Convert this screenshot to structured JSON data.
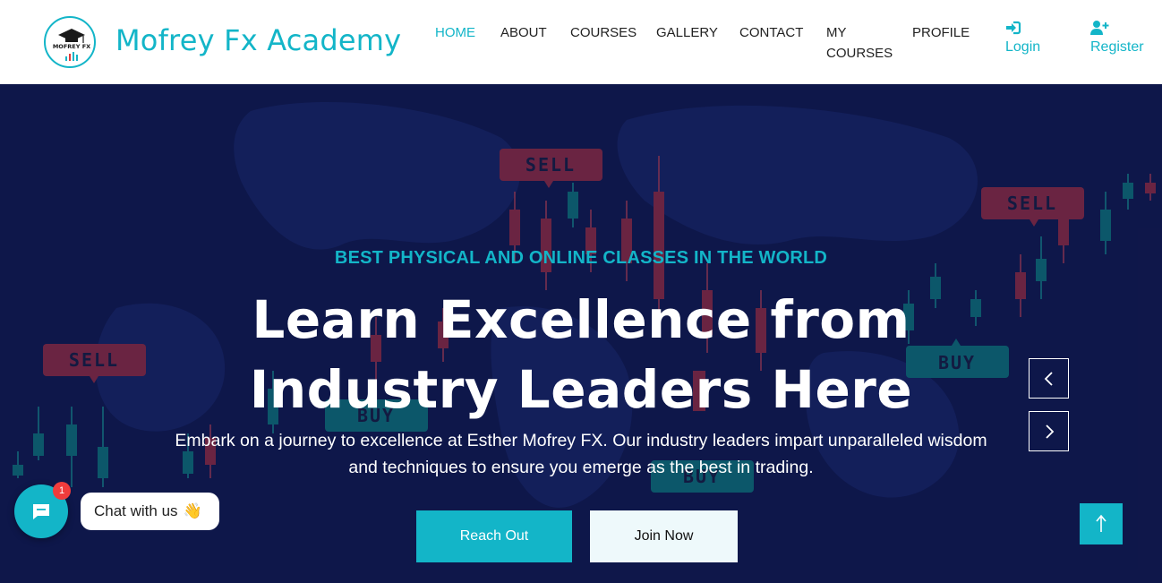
{
  "brand": {
    "name": "Mofrey Fx Academy",
    "logo_text": "MOFREY FX"
  },
  "nav": {
    "items": [
      {
        "label": "HOME",
        "active": true
      },
      {
        "label": "ABOUT"
      },
      {
        "label": "COURSES"
      },
      {
        "label": "GALLERY"
      },
      {
        "label": "CONTACT"
      },
      {
        "label_line1": "MY",
        "label_line2": "COURSES"
      },
      {
        "label": "PROFILE"
      }
    ],
    "login": {
      "label": "Login",
      "icon": "sign-in-icon"
    },
    "register": {
      "label": "Register",
      "icon": "user-plus-icon"
    }
  },
  "hero": {
    "eyebrow": "BEST PHYSICAL AND ONLINE CLASSES IN THE WORLD",
    "headline_line1": "Learn Excellence from",
    "headline_line2": "Industry Leaders Here",
    "lead_line1": "Embark on a journey to excellence at Esther Mofrey FX. Our industry leaders impart unparalleled wisdom",
    "lead_line2": "and techniques to ensure you emerge as the best in trading.",
    "primary_button": "Reach Out",
    "secondary_button": "Join Now",
    "background_tags": [
      "SELL",
      "SELL",
      "SELL",
      "BUY",
      "BUY",
      "BUY"
    ]
  },
  "chat": {
    "label": "Chat with us",
    "emoji": "👋",
    "badge_count": "1"
  },
  "colors": {
    "accent": "#13b5c8",
    "hero_bg": "#111a4d",
    "sell_red": "#b8323f",
    "buy_teal": "#0e8f87"
  }
}
